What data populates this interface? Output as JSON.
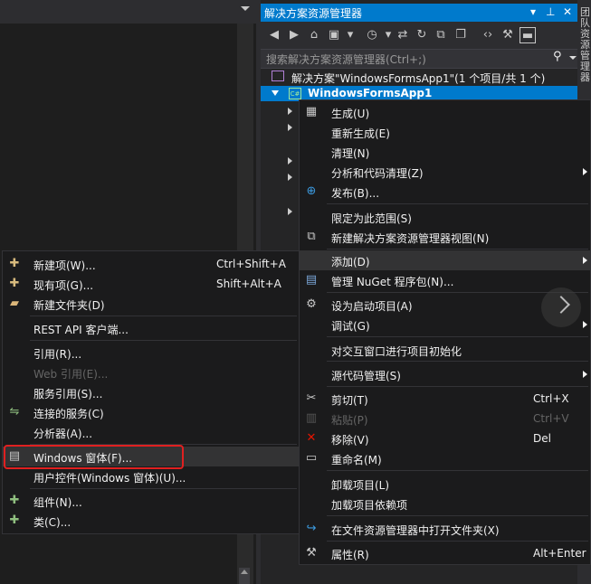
{
  "solution_explorer": {
    "title": "解决方案资源管理器",
    "pin_icon": "pin-icon",
    "close_glyph": "✕",
    "search_placeholder": "搜索解决方案资源管理器(Ctrl+;)",
    "solution_label": "解决方案\"WindowsFormsApp1\"(1 个项目/共 1 个)",
    "project_label": "WindowsFormsApp1",
    "project_icon_text": "C#",
    "right_strip_text": "团队资源管理器"
  },
  "context_menu": {
    "items": [
      {
        "label": "生成(U)",
        "icon": "build-icon"
      },
      {
        "label": "重新生成(E)"
      },
      {
        "label": "清理(N)"
      },
      {
        "label": "分析和代码清理(Z)",
        "submenu": true
      },
      {
        "label": "发布(B)...",
        "icon": "globe-icon"
      },
      {
        "label": "限定为此范围(S)"
      },
      {
        "label": "新建解决方案资源管理器视图(N)",
        "icon": "new-view-icon"
      },
      {
        "label": "添加(D)",
        "submenu": true,
        "highlighted": true
      },
      {
        "label": "管理 NuGet 程序包(N)...",
        "icon": "nuget-icon"
      },
      {
        "label": "设为启动项目(A)",
        "icon": "gear-icon"
      },
      {
        "label": "调试(G)",
        "submenu": true
      },
      {
        "label": "对交互窗口进行项目初始化"
      },
      {
        "label": "源代码管理(S)",
        "submenu": true
      },
      {
        "label": "剪切(T)",
        "shortcut": "Ctrl+X",
        "icon": "scissors-icon"
      },
      {
        "label": "粘贴(P)",
        "shortcut": "Ctrl+V",
        "disabled": true,
        "icon": "paste-icon"
      },
      {
        "label": "移除(V)",
        "shortcut": "Del",
        "icon": "remove-icon"
      },
      {
        "label": "重命名(M)",
        "icon": "rename-icon"
      },
      {
        "label": "卸载项目(L)"
      },
      {
        "label": "加载项目依赖项"
      },
      {
        "label": "在文件资源管理器中打开文件夹(X)",
        "icon": "refresh-open-icon"
      },
      {
        "label": "属性(R)",
        "shortcut": "Alt+Enter",
        "icon": "wrench-icon"
      }
    ]
  },
  "add_submenu": {
    "items": [
      {
        "label": "新建项(W)...",
        "shortcut": "Ctrl+Shift+A",
        "icon": "new-item-icon"
      },
      {
        "label": "现有项(G)...",
        "shortcut": "Shift+Alt+A",
        "icon": "existing-item-icon"
      },
      {
        "label": "新建文件夹(D)",
        "icon": "folder-icon"
      },
      {
        "label": "REST API 客户端..."
      },
      {
        "label": "引用(R)..."
      },
      {
        "label": "Web 引用(E)...",
        "disabled": true
      },
      {
        "label": "服务引用(S)..."
      },
      {
        "label": "连接的服务(C)",
        "icon": "connected-service-icon"
      },
      {
        "label": "分析器(A)..."
      },
      {
        "label": "Windows 窗体(F)...",
        "icon": "windows-form-icon",
        "highlighted": true
      },
      {
        "label": "用户控件(Windows 窗体)(U)..."
      },
      {
        "label": "组件(N)...",
        "icon": "component-icon"
      },
      {
        "label": "类(C)...",
        "icon": "class-icon"
      }
    ]
  },
  "colors": {
    "accent": "#007acc",
    "annotation_red": "#e02020"
  }
}
